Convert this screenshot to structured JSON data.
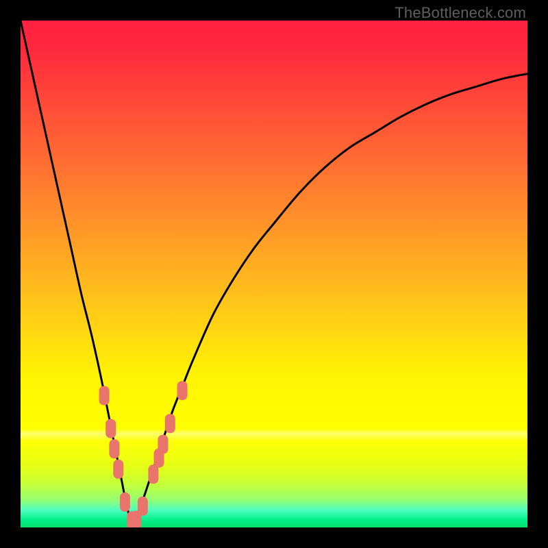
{
  "watermark": "TheBottleneck.com",
  "colors": {
    "frame": "#000000",
    "curve": "#000000",
    "marker_fill": "#e9746c",
    "gradient_stops": [
      {
        "offset": 0.0,
        "color": "#ff203f"
      },
      {
        "offset": 0.06,
        "color": "#ff2a3e"
      },
      {
        "offset": 0.15,
        "color": "#ff4639"
      },
      {
        "offset": 0.28,
        "color": "#ff6d32"
      },
      {
        "offset": 0.4,
        "color": "#ff9329"
      },
      {
        "offset": 0.55,
        "color": "#ffc31a"
      },
      {
        "offset": 0.7,
        "color": "#fff304"
      },
      {
        "offset": 0.805,
        "color": "#ffff00"
      },
      {
        "offset": 0.815,
        "color": "#ffff6e"
      },
      {
        "offset": 0.83,
        "color": "#ffff04"
      },
      {
        "offset": 0.88,
        "color": "#e4ff15"
      },
      {
        "offset": 0.915,
        "color": "#c4ff3a"
      },
      {
        "offset": 0.945,
        "color": "#96ff70"
      },
      {
        "offset": 0.965,
        "color": "#52ffbf"
      },
      {
        "offset": 0.985,
        "color": "#03ef8a"
      },
      {
        "offset": 1.0,
        "color": "#02e06d"
      }
    ]
  },
  "chart_data": {
    "type": "line",
    "title": "",
    "xlabel": "",
    "ylabel": "",
    "x_range": [
      0,
      100
    ],
    "y_range": [
      0,
      100
    ],
    "note": "Values estimated from pixels; curve is a V-shaped bottleneck curve with minimum near x≈22, y≈0.",
    "series": [
      {
        "name": "bottleneck-curve",
        "x": [
          0,
          2,
          4,
          6,
          8,
          10,
          12,
          14,
          16,
          18,
          19,
          20,
          21,
          22,
          23,
          24,
          25,
          26,
          28,
          30,
          32,
          34,
          38,
          42,
          46,
          50,
          55,
          60,
          65,
          70,
          75,
          80,
          85,
          90,
          95,
          100
        ],
        "y": [
          100,
          91,
          82,
          73,
          64,
          55,
          46,
          38,
          29,
          19,
          14,
          9,
          4,
          1,
          2,
          5,
          8,
          11,
          17,
          23,
          28,
          33,
          42,
          49,
          55,
          60,
          66,
          71,
          75,
          78,
          81,
          83.5,
          85.5,
          87,
          88.5,
          89.5
        ]
      }
    ],
    "markers": {
      "name": "highlighted-points",
      "shape": "rounded-rect",
      "points": [
        {
          "x": 16.5,
          "y": 26.0
        },
        {
          "x": 17.8,
          "y": 19.5
        },
        {
          "x": 18.5,
          "y": 15.5
        },
        {
          "x": 19.3,
          "y": 11.5
        },
        {
          "x": 20.6,
          "y": 5.0
        },
        {
          "x": 22.0,
          "y": 1.3
        },
        {
          "x": 22.8,
          "y": 1.4
        },
        {
          "x": 24.1,
          "y": 4.2
        },
        {
          "x": 26.2,
          "y": 10.5
        },
        {
          "x": 27.3,
          "y": 13.7
        },
        {
          "x": 28.1,
          "y": 16.4
        },
        {
          "x": 29.5,
          "y": 20.5
        },
        {
          "x": 31.9,
          "y": 27.0
        }
      ]
    }
  }
}
